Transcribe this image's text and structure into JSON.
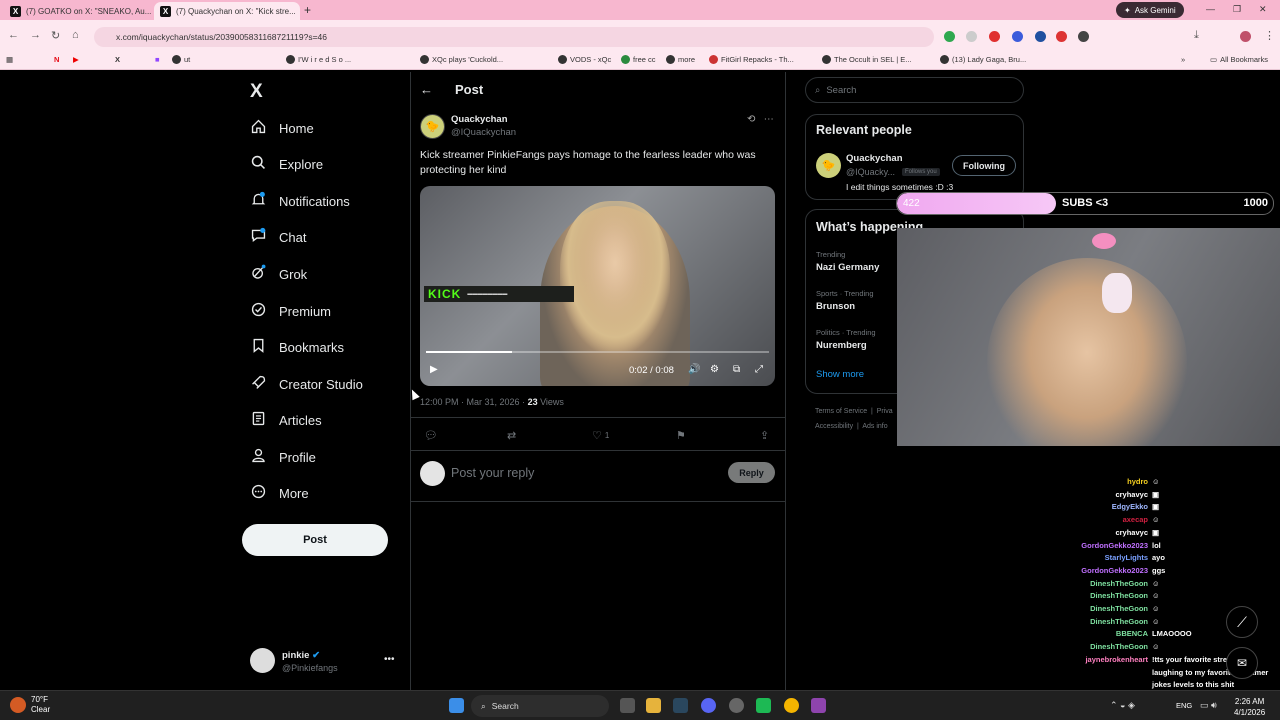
{
  "browser": {
    "tabs": [
      {
        "label": "(7) GOATKO on X: \"SNEAKO, Au..."
      },
      {
        "label": "(7) Quackychan on X: \"Kick stre..."
      }
    ],
    "ask_gemini": "Ask Gemini",
    "url": "x.com/iquackychan/status/2039005831168721119?s=46",
    "bookmarks": [
      "ut",
      "I'W i r e d   S o ...",
      "XQc plays 'Cuckold...",
      "VODS - xQc",
      "free cc",
      "more",
      "FitGirl Repacks - Th...",
      "The Occult in SEL | E...",
      "(13) Lady Gaga, Bru..."
    ],
    "all_bookmarks": "All Bookmarks"
  },
  "nav": {
    "logo": "X",
    "items": [
      {
        "label": "Home",
        "icon": "home-icon"
      },
      {
        "label": "Explore",
        "icon": "search-icon"
      },
      {
        "label": "Notifications",
        "icon": "bell-icon"
      },
      {
        "label": "Chat",
        "icon": "chat-icon"
      },
      {
        "label": "Grok",
        "icon": "grok-icon"
      },
      {
        "label": "Premium",
        "icon": "premium-icon"
      },
      {
        "label": "Bookmarks",
        "icon": "bookmark-icon"
      },
      {
        "label": "Creator Studio",
        "icon": "rocket-icon"
      },
      {
        "label": "Articles",
        "icon": "article-icon"
      },
      {
        "label": "Profile",
        "icon": "profile-icon"
      },
      {
        "label": "More",
        "icon": "more-icon"
      }
    ],
    "post_button": "Post",
    "account": {
      "name": "pinkie",
      "handle": "@Pinkiefangs"
    }
  },
  "post": {
    "header": "Post",
    "author_name": "Quackychan",
    "author_handle": "@IQuackychan",
    "text": "Kick streamer PinkieFangs pays homage to the fearless leader who was protecting her kind",
    "video": {
      "watermark": "KICK",
      "time": "0:02 / 0:08",
      "progress": 0.25
    },
    "meta_time": "12:00 PM · Mar 31, 2026 · ",
    "views_count": "23",
    "views_label": " Views",
    "like_count": "1",
    "reply_placeholder": "Post your reply",
    "reply_button": "Reply"
  },
  "sidebar": {
    "search_placeholder": "Search",
    "relevant_title": "Relevant people",
    "relevant": {
      "name": "Quackychan",
      "handle": "@IQuacky...",
      "follows_you": "Follows you",
      "bio": "I edit things sometimes :D :3",
      "follow_button": "Following"
    },
    "happening_title": "What’s happening",
    "trends": [
      {
        "meta": "Trending",
        "name": "Nazi Germany"
      },
      {
        "meta": "Sports · Trending",
        "name": "Brunson"
      },
      {
        "meta": "Politics · Trending",
        "name": "Nuremberg"
      }
    ],
    "show_more": "Show more",
    "footer": [
      "Terms of Service",
      "Priva",
      "Accessibility",
      "Ads info"
    ]
  },
  "overlay": {
    "subs_current": "422",
    "subs_label": "SUBS <3",
    "subs_goal": "1000",
    "subs_fraction": 0.422,
    "chat": [
      {
        "user": "hydro",
        "color": "#f5d020",
        "msg": "☺"
      },
      {
        "user": "cryhavyc",
        "color": "#ffffff",
        "msg": "▣"
      },
      {
        "user": "EdgyEkko",
        "color": "#9fb7ff",
        "msg": "▣"
      },
      {
        "user": "axecap",
        "color": "#d02040",
        "msg": "☺"
      },
      {
        "user": "cryhavyc",
        "color": "#ffffff",
        "msg": "▣"
      },
      {
        "user": "GordonGekko2023",
        "color": "#c070ff",
        "msg": "lol"
      },
      {
        "user": "StarlyLights",
        "color": "#7aa0ff",
        "msg": "ayo"
      },
      {
        "user": "GordonGekko2023",
        "color": "#c070ff",
        "msg": "ggs"
      },
      {
        "user": "DineshTheGoon",
        "color": "#7ee0a0",
        "msg": "☺"
      },
      {
        "user": "DineshTheGoon",
        "color": "#7ee0a0",
        "msg": "☺"
      },
      {
        "user": "DineshTheGoon",
        "color": "#7ee0a0",
        "msg": "☺"
      },
      {
        "user": "DineshTheGoon",
        "color": "#7ee0a0",
        "msg": "☺"
      },
      {
        "user": "BBENCA",
        "color": "#7ee0a0",
        "msg": "LMAOOOO"
      },
      {
        "user": "DineshTheGoon",
        "color": "#7ee0a0",
        "msg": "☺"
      },
      {
        "user": "jaynebrokenheart",
        "color": "#ff80c0",
        "msg": "!tts your favorite streamer is"
      },
      {
        "user": "",
        "color": "#ffffff",
        "msg": "laughing to my favorite streamer"
      },
      {
        "user": "",
        "color": "#ffffff",
        "msg": "jokes levels to this shit"
      }
    ]
  },
  "taskbar": {
    "weather_temp": "70°F",
    "weather_desc": "Clear",
    "search": "Search",
    "lang": "ENG",
    "time": "2:26 AM",
    "date": "4/1/2026"
  },
  "colors": {
    "accent": "#1d9bf0",
    "kick_green": "#53fc18",
    "tab_bg": "#f7b7cf"
  }
}
